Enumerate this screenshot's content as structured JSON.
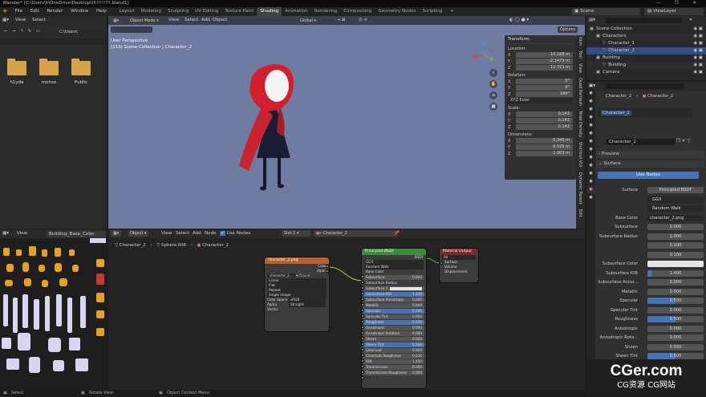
{
  "title_bar": {
    "text": "Blender* [C:\\Users\\h\\OneDrive\\Desktop\\U\\!!!!!!!!.blend1]",
    "controls": "— ❐ ✕"
  },
  "menu": {
    "items": [
      "File",
      "Edit",
      "Render",
      "Window",
      "Help"
    ]
  },
  "workspaces": [
    {
      "label": "Layout",
      "active": false
    },
    {
      "label": "Modeling",
      "active": false
    },
    {
      "label": "Sculpting",
      "active": false
    },
    {
      "label": "UV Editing",
      "active": false
    },
    {
      "label": "Texture Paint",
      "active": false
    },
    {
      "label": "Shading",
      "active": true
    },
    {
      "label": "Animation",
      "active": false
    },
    {
      "label": "Rendering",
      "active": false
    },
    {
      "label": "Compositing",
      "active": false
    },
    {
      "label": "Geometry Nodes",
      "active": false
    },
    {
      "label": "Scripting",
      "active": false
    }
  ],
  "add_workspace": "+",
  "scene": {
    "label": "Scene"
  },
  "view_layer": {
    "label": "ViewLayer"
  },
  "file_browser": {
    "menu": [
      "View",
      "Select"
    ],
    "path": "C:\\Users\\",
    "folders": [
      {
        "label": "h1yda"
      },
      {
        "label": "mohse"
      },
      {
        "label": "Public"
      }
    ]
  },
  "viewport": {
    "mode": "Object Mode",
    "menu": [
      "View",
      "Select",
      "Add",
      "Object"
    ],
    "orientation": "Global",
    "info_line1": "User Perspective",
    "info_line2": "(113) Scene Collection | Character_2",
    "options": "Options"
  },
  "transform": {
    "title": "Transform",
    "location_label": "Location:",
    "location": [
      {
        "axis": "X",
        "value": "10.168 m"
      },
      {
        "axis": "Y",
        "value": "-2.1473 m"
      },
      {
        "axis": "Z",
        "value": "11.721 m"
      }
    ],
    "rotation_label": "Rotation:",
    "rotation": [
      {
        "axis": "X",
        "value": "0°"
      },
      {
        "axis": "Y",
        "value": "0°"
      },
      {
        "axis": "Z",
        "value": "180°"
      }
    ],
    "rotation_mode": "XYZ Euler",
    "scale_label": "Scale:",
    "scale": [
      {
        "axis": "X",
        "value": "0.143"
      },
      {
        "axis": "Y",
        "value": "0.143"
      },
      {
        "axis": "Z",
        "value": "0.143"
      }
    ],
    "dimensions_label": "Dimensions:",
    "dimensions": [
      {
        "axis": "X",
        "value": "0.346 m"
      },
      {
        "axis": "Y",
        "value": "0.525 m"
      },
      {
        "axis": "Z",
        "value": "1.003 m"
      }
    ]
  },
  "side_tabs": [
    "Item",
    "Tool",
    "View",
    "Quad Remesh",
    "Texel Density",
    "Shortcut VUr",
    "Dynamic Parent",
    "Edit"
  ],
  "outliner": {
    "search": "",
    "items": [
      {
        "label": "Scene Collection",
        "level": 0
      },
      {
        "label": "Characters",
        "level": 1
      },
      {
        "label": "Character_1",
        "level": 2
      },
      {
        "label": "Character_2",
        "level": 2
      },
      {
        "label": "Building",
        "level": 1
      },
      {
        "label": "Building",
        "level": 2
      },
      {
        "label": "Camera",
        "level": 1
      }
    ]
  },
  "properties": {
    "breadcrumb": [
      "Character_2",
      "Character_2"
    ],
    "material_slot": "Character_2",
    "material_name": "Character_2",
    "preview": "Preview",
    "surface_label": "Surface",
    "use_nodes": "Use Nodes",
    "rows": [
      {
        "label": "Surface",
        "value": "Principled BSDF"
      },
      {
        "label": "",
        "value": "GGX"
      },
      {
        "label": "",
        "value": "Random Walk"
      },
      {
        "label": "Base Color",
        "value": "character_2.png"
      },
      {
        "label": "Subsurface",
        "value": "0.000"
      },
      {
        "label": "Subsurface Radius",
        "value": "1.000"
      },
      {
        "label": "",
        "value": "0.200"
      },
      {
        "label": "",
        "value": "0.100"
      },
      {
        "label": "Subsurface Color",
        "value": ""
      },
      {
        "label": "Subsurface IOR",
        "value": "1.400"
      },
      {
        "label": "Subsurface Aniso...",
        "value": "0.000"
      },
      {
        "label": "Metallic",
        "value": "0.000"
      },
      {
        "label": "Specular",
        "value": "0.500"
      },
      {
        "label": "Specular Tint",
        "value": "0.000"
      },
      {
        "label": "Roughness",
        "value": "0.500"
      },
      {
        "label": "Anisotropic",
        "value": "0.000"
      },
      {
        "label": "Anisotropic Rota...",
        "value": "0.000"
      },
      {
        "label": "Sheen",
        "value": "0.000"
      },
      {
        "label": "Sheen Tint",
        "value": "0.500"
      }
    ]
  },
  "image_editor": {
    "menu": [
      "View"
    ],
    "image": "Building_Base_Color"
  },
  "node_editor": {
    "type": "Object",
    "menu": [
      "View",
      "Select",
      "Add",
      "Node"
    ],
    "use_nodes": "Use Nodes",
    "slot": "Slot 1",
    "material": "Character_2",
    "breadcrumb": [
      "Character_2",
      "Sphere.006",
      "Character_2"
    ],
    "image_node": {
      "title": "character_2.png",
      "outputs": [
        "Color",
        "Alpha"
      ],
      "file": "character_2...",
      "rows": [
        "Linear",
        "Flat",
        "Repeat",
        "Single Image"
      ],
      "color_space_label": "Color Space",
      "color_space": "sRGB",
      "alpha_label": "Alpha",
      "alpha": "Straight",
      "vector": "Vector"
    },
    "bsdf_node": {
      "title": "Principled BSDF",
      "output": "BSDF",
      "dist": "GGX",
      "sss": "Random Walk",
      "rows": [
        {
          "l": "Base Color",
          "v": ""
        },
        {
          "l": "Subsurface",
          "v": "0.000"
        },
        {
          "l": "Subsurface Radius",
          "v": ""
        },
        {
          "l": "Subsurface C...",
          "v": ""
        },
        {
          "l": "Subsurface IOR",
          "v": "1.400"
        },
        {
          "l": "Subsurface Anisotropy",
          "v": "0.000"
        },
        {
          "l": "Metallic",
          "v": "0.000"
        },
        {
          "l": "Specular",
          "v": "0.500"
        },
        {
          "l": "Specular Tint",
          "v": "0.000"
        },
        {
          "l": "Roughness",
          "v": "0.500"
        },
        {
          "l": "Anisotropic",
          "v": "0.000"
        },
        {
          "l": "Anisotropic Rotation",
          "v": "0.000"
        },
        {
          "l": "Sheen",
          "v": "0.000"
        },
        {
          "l": "Sheen Tint",
          "v": "0.500"
        },
        {
          "l": "Clearcoat",
          "v": "0.000"
        },
        {
          "l": "Clearcoat Roughness",
          "v": "0.030"
        },
        {
          "l": "IOR",
          "v": "1.450"
        },
        {
          "l": "Transmission",
          "v": "0.000"
        },
        {
          "l": "Transmission Roughness",
          "v": "0.000"
        }
      ]
    },
    "output_node": {
      "title": "Material Output",
      "target": "All",
      "inputs": [
        "Surface",
        "Volume",
        "Displacement"
      ]
    }
  },
  "status": {
    "left": "Select",
    "mid": "Rotate View",
    "right": "Object Context Menu"
  },
  "watermark": {
    "line1": "CGer.com",
    "line2": "CG资源 CG网站"
  },
  "colors": {
    "viewport_bg": "#6f7ba1",
    "node_image_header": "#b8612a",
    "node_shader_header": "#3c8a3c",
    "node_output_header": "#7a2c2c",
    "accent": "#4772b3",
    "folder": "#d8a24a"
  }
}
